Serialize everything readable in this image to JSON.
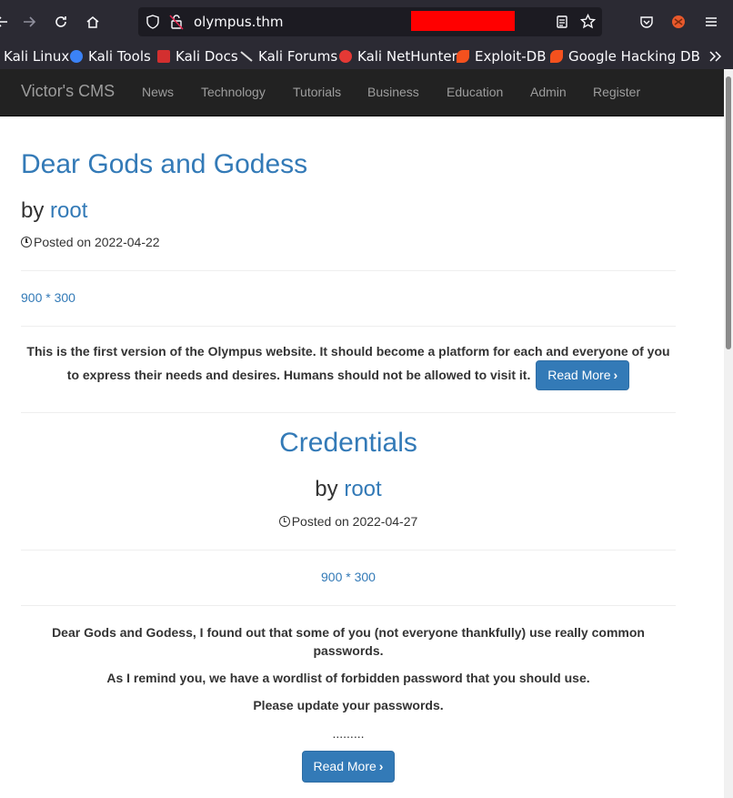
{
  "browser": {
    "url": "olympus.thm",
    "bookmarks": [
      {
        "label": "Kali Linux",
        "icon": "kali-icon",
        "color": "#2b2a33"
      },
      {
        "label": "Kali Tools",
        "icon": "kali-tools-icon",
        "color": "#3b82f6"
      },
      {
        "label": "Kali Docs",
        "icon": "kali-docs-icon",
        "color": "#d32f2f"
      },
      {
        "label": "Kali Forums",
        "icon": "kali-forums-icon",
        "color": "#cccccc"
      },
      {
        "label": "Kali NetHunter",
        "icon": "nethunter-icon",
        "color": "#e53935"
      },
      {
        "label": "Exploit-DB",
        "icon": "exploit-db-icon",
        "color": "#f4511e"
      },
      {
        "label": "Google Hacking DB",
        "icon": "ghdb-icon",
        "color": "#f4511e"
      }
    ]
  },
  "navbar": {
    "brand": "Victor's CMS",
    "items": [
      "News",
      "Technology",
      "Tutorials",
      "Business",
      "Education",
      "Admin",
      "Register"
    ]
  },
  "posts": [
    {
      "title": "Dear Gods and Godess",
      "by": "by",
      "author": "root",
      "posted": "Posted on 2022-04-22",
      "image": "900 * 300",
      "body": [
        "This is the first version of the Olympus website. It should become a platform for each and everyone of you to express their needs and desires. Humans should not be allowed to visit it."
      ],
      "read_more": "Read More"
    },
    {
      "title": "Credentials",
      "by": "by",
      "author": "root",
      "posted": "Posted on 2022-04-27",
      "image": "900 * 300",
      "body": [
        "Dear Gods and Godess, I found out that some of you (not everyone thankfully) use really common passwords.",
        "As I remind you, we have a wordlist of forbidden password that you should use.",
        "Please update your passwords.",
        "........."
      ],
      "read_more": "Read More"
    }
  ],
  "colors": {
    "link": "#337ab7",
    "navbar_bg": "#222222",
    "browser_bg": "#2b2a33"
  }
}
